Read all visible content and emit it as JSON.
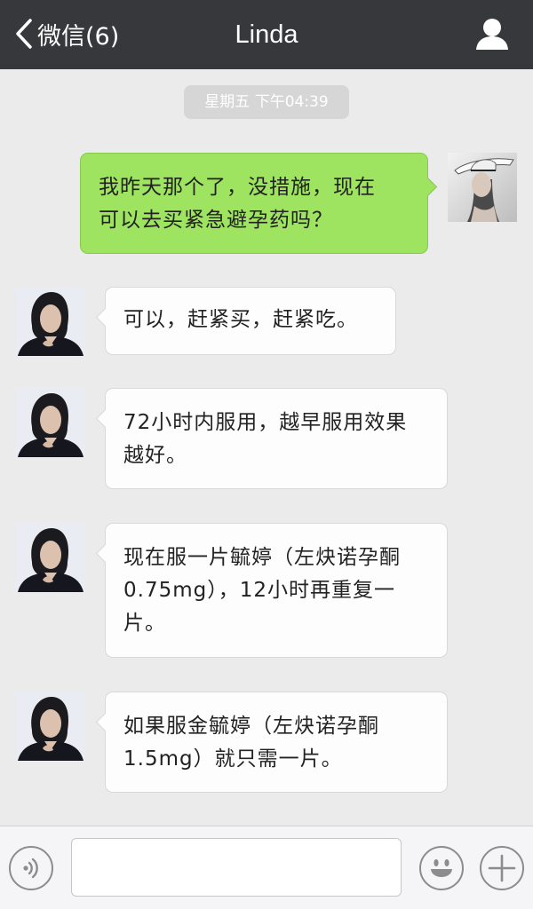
{
  "header": {
    "back_label": "微信(6)",
    "title": "Linda"
  },
  "timestamp": "星期五 下午04:39",
  "messages": [
    {
      "side": "outgoing",
      "lines": [
        "我昨天那个了，没措施，现在",
        "可以去买紧急避孕药吗？"
      ]
    },
    {
      "side": "incoming",
      "lines": [
        "可以，赶紧买，赶紧吃。"
      ]
    },
    {
      "side": "incoming",
      "lines": [
        "72小时内服用，越早服用效果",
        "越好。"
      ]
    },
    {
      "side": "incoming",
      "lines": [
        "现在服一片毓婷（左炔诺孕酮",
        "0.75mg），12小时再重复一",
        "片。"
      ]
    },
    {
      "side": "incoming",
      "lines": [
        "如果服金毓婷（左炔诺孕酮",
        "1.5mg）就只需一片。"
      ]
    }
  ],
  "input": {
    "value": "",
    "placeholder": ""
  },
  "icons": {
    "back": "chevron-left-icon",
    "profile": "person-icon",
    "voice": "voice-icon",
    "emoji": "smiley-icon",
    "more": "plus-icon"
  },
  "colors": {
    "topbar": "#37383c",
    "outgoing_bubble": "#9fe461",
    "incoming_bubble": "#fdfdfd",
    "background": "#ebebeb"
  }
}
